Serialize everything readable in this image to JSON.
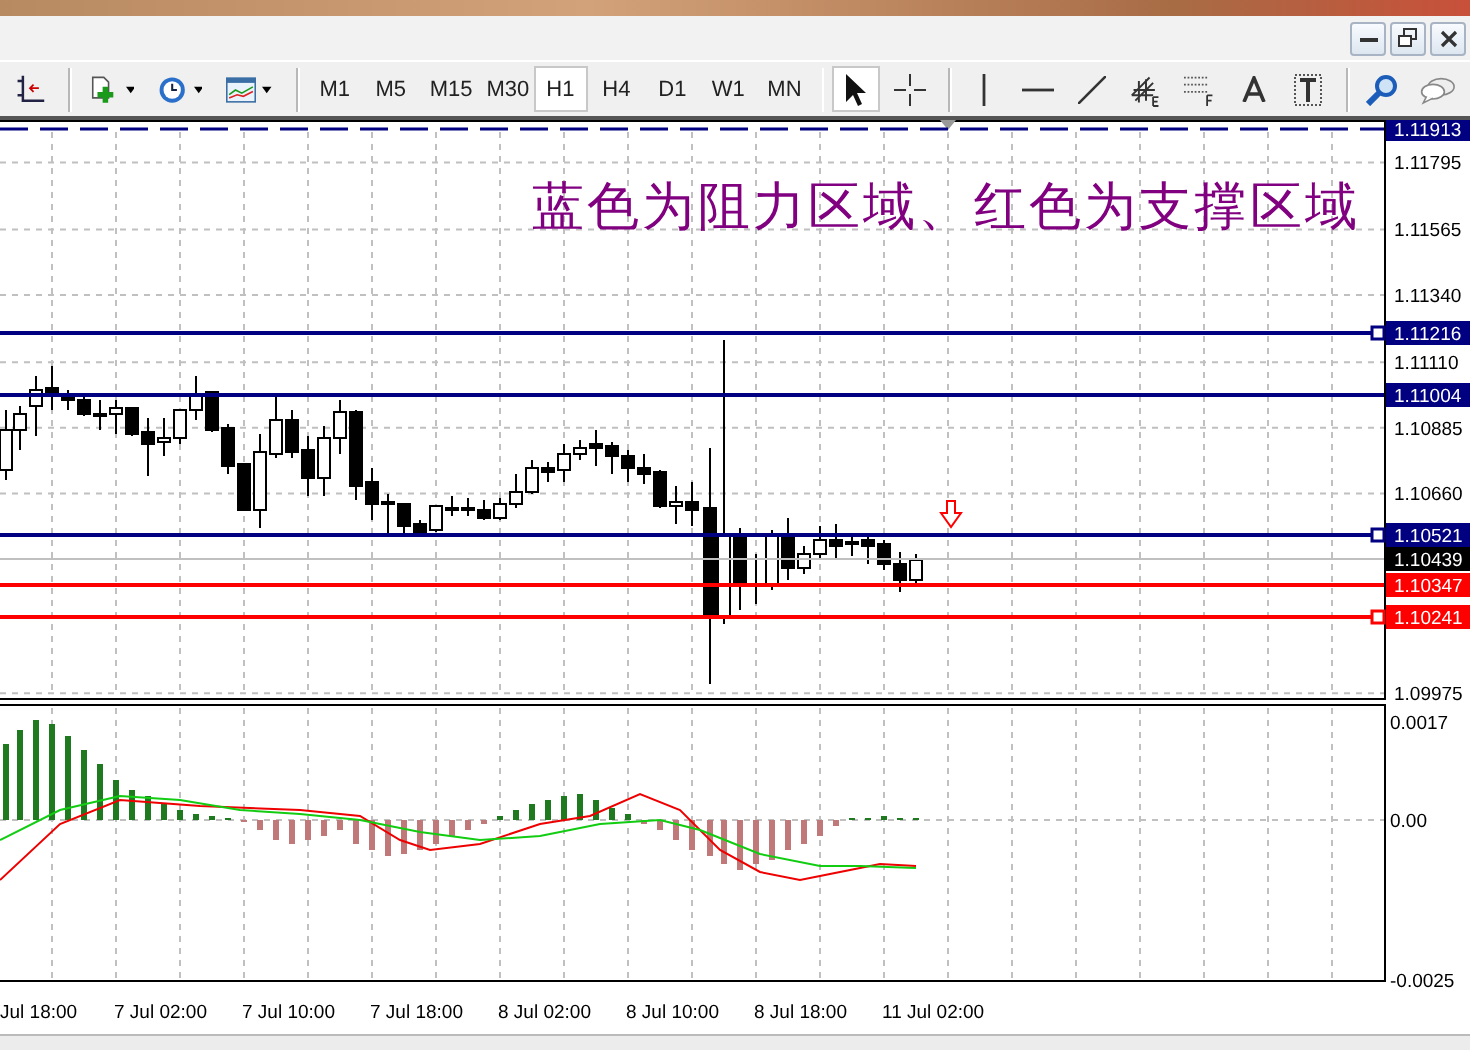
{
  "toolbar": {
    "timeframes": [
      {
        "label": "M1",
        "selected": false
      },
      {
        "label": "M5",
        "selected": false
      },
      {
        "label": "M15",
        "selected": false
      },
      {
        "label": "M30",
        "selected": false
      },
      {
        "label": "H1",
        "selected": true
      },
      {
        "label": "H4",
        "selected": false
      },
      {
        "label": "D1",
        "selected": false
      },
      {
        "label": "W1",
        "selected": false
      },
      {
        "label": "MN",
        "selected": false
      }
    ]
  },
  "chart": {
    "annotation": "蓝色为阻力区域、红色为支撑区域",
    "price_ticks": [
      "1.11795",
      "1.11565",
      "1.11340",
      "1.11110",
      "1.10885",
      "1.10660",
      "1.09975"
    ],
    "levels": [
      {
        "label": "1.11913",
        "kind": "dashed",
        "color": "#000080",
        "anchor": false
      },
      {
        "label": "1.11216",
        "kind": "solid",
        "color": "#000080",
        "anchor": true
      },
      {
        "label": "1.11004",
        "kind": "solid",
        "color": "#000080",
        "anchor": false
      },
      {
        "label": "1.10521",
        "kind": "solid",
        "color": "#000080",
        "anchor": true
      },
      {
        "label": "1.10439",
        "kind": "bid",
        "color": "#000000",
        "anchor": false
      },
      {
        "label": "1.10347",
        "kind": "solid",
        "color": "#ff0000",
        "anchor": false
      },
      {
        "label": "1.10241",
        "kind": "solid",
        "color": "#ff0000",
        "anchor": true
      }
    ],
    "indicator_ticks": [
      "0.0017",
      "0.00",
      "-0.0025"
    ],
    "time_labels": [
      "Jul 18:00",
      "7 Jul 02:00",
      "7 Jul 10:00",
      "7 Jul 18:00",
      "8 Jul 02:00",
      "8 Jul 10:00",
      "8 Jul 18:00",
      "11 Jul 02:00"
    ]
  }
}
